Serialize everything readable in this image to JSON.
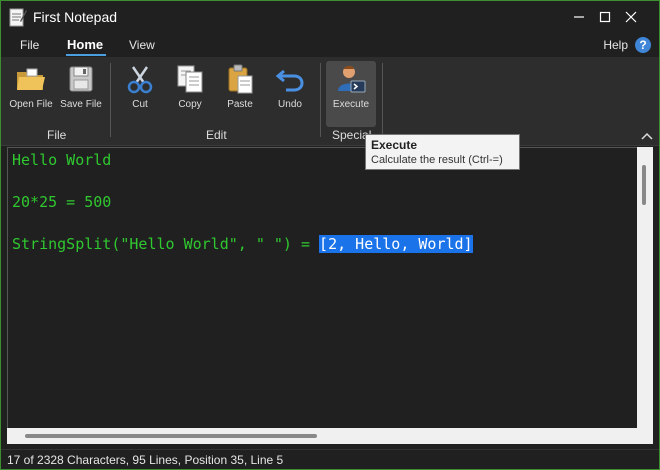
{
  "window": {
    "title": "First Notepad"
  },
  "tabs": [
    "File",
    "Home",
    "View"
  ],
  "help_label": "Help",
  "help_icon": "?",
  "ribbon": {
    "buttons": [
      {
        "label": "Open File",
        "icon": "folder-icon"
      },
      {
        "label": "Save File",
        "icon": "save-icon"
      },
      {
        "label": "Cut",
        "icon": "scissors-icon"
      },
      {
        "label": "Copy",
        "icon": "copy-icon"
      },
      {
        "label": "Paste",
        "icon": "paste-icon"
      },
      {
        "label": "Undo",
        "icon": "undo-icon"
      },
      {
        "label": "Execute",
        "icon": "execute-user-icon"
      }
    ],
    "groups": [
      "File",
      "Edit",
      "Special"
    ]
  },
  "editor": {
    "lines": [
      "Hello World",
      "",
      "20*25 = 500",
      "",
      "StringSplit(\"Hello World\", \" \") = "
    ],
    "selected_text": "[2, Hello, World]"
  },
  "tooltip": {
    "title": "Execute",
    "description": "Calculate the result (Ctrl-=)"
  },
  "status": "17 of 2328 Characters, 95 Lines, Position 35, Line 5",
  "colors": {
    "code": "#2fc82f",
    "selection": "#1a73e8",
    "accent": "#4a9fe0",
    "border": "#3c8f2f"
  }
}
